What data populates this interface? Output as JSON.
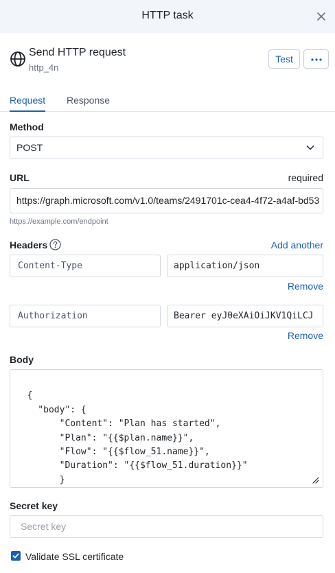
{
  "header": {
    "title": "HTTP task"
  },
  "task": {
    "title": "Send HTTP request",
    "subtitle": "http_4n",
    "test_label": "Test"
  },
  "tabs": [
    {
      "label": "Request",
      "active": true
    },
    {
      "label": "Response",
      "active": false
    }
  ],
  "method": {
    "label": "Method",
    "value": "POST"
  },
  "url": {
    "label": "URL",
    "required_text": "required",
    "value": "https://graph.microsoft.com/v1.0/teams/2491701c-cea4-4f72-a4af-bd53",
    "hint": "https://example.com/endpoint"
  },
  "headers": {
    "label": "Headers",
    "add_label": "Add another",
    "remove_label": "Remove",
    "items": [
      {
        "key": "Content-Type",
        "value": "application/json"
      },
      {
        "key": "Authorization",
        "value": "Bearer eyJ0eXAiOiJKV1QiLCJ"
      }
    ]
  },
  "body": {
    "label": "Body",
    "value": "{\n    \"body\": {\n        \"Content\": \"Plan has started\",\n        \"Plan\": \"{{$plan.name}}\",\n        \"Flow\": \"{{$flow_51.name}}\",\n        \"Duration\": \"{{$flow_51.duration}}\"\n        }\n}"
  },
  "secret_key": {
    "label": "Secret key",
    "placeholder": "Secret key"
  },
  "ssl": {
    "label": "Validate SSL certificate",
    "checked": true
  },
  "colors": {
    "accent": "#1a5fb4",
    "header_bg": "#f2f5f9",
    "border": "#d3d9e1"
  },
  "icons": {
    "close": "close-icon",
    "globe": "globe-icon",
    "more": "more-horizontal-icon",
    "help": "help-circle-icon",
    "chevron": "chevron-down-icon",
    "check": "check-icon"
  }
}
